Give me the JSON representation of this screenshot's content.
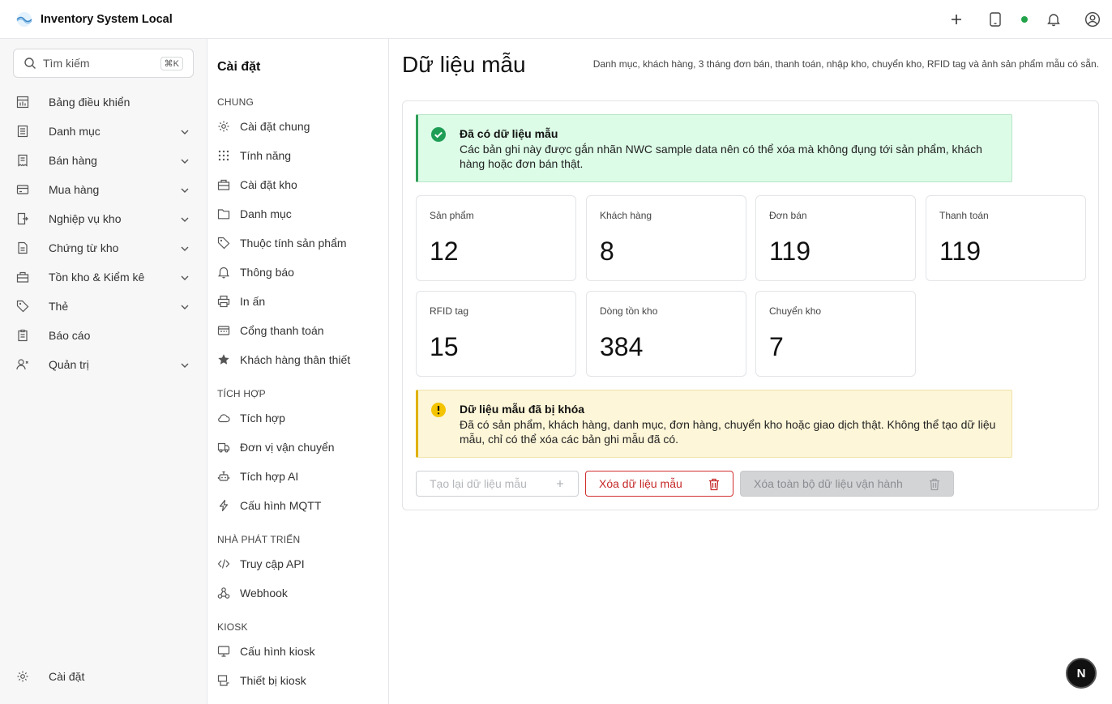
{
  "app": {
    "title": "Inventory System Local"
  },
  "topbar": {
    "actions": [
      "plus-icon",
      "tablet-icon",
      "status-dot",
      "bell-icon",
      "user-circle-icon"
    ],
    "status_color": "#22a34a"
  },
  "search": {
    "placeholder": "Tìm kiếm",
    "shortcut": "⌘K"
  },
  "sidebar": {
    "items": [
      {
        "label": "Bảng điều khiển",
        "icon": "dashboard-icon",
        "expandable": false
      },
      {
        "label": "Danh mục",
        "icon": "catalog-icon",
        "expandable": true
      },
      {
        "label": "Bán hàng",
        "icon": "receipt-icon",
        "expandable": true
      },
      {
        "label": "Mua hàng",
        "icon": "card-icon",
        "expandable": true
      },
      {
        "label": "Nghiệp vụ kho",
        "icon": "warehouse-ops-icon",
        "expandable": true
      },
      {
        "label": "Chứng từ kho",
        "icon": "document-icon",
        "expandable": true
      },
      {
        "label": "Tồn kho & Kiểm kê",
        "icon": "inventory-icon",
        "expandable": true
      },
      {
        "label": "Thẻ",
        "icon": "tag-icon",
        "expandable": true
      },
      {
        "label": "Báo cáo",
        "icon": "report-icon",
        "expandable": false
      },
      {
        "label": "Quản trị",
        "icon": "admin-icon",
        "expandable": true
      }
    ],
    "settings_label": "Cài đặt"
  },
  "settings_nav": {
    "title": "Cài đặt",
    "sections": [
      {
        "heading": "CHUNG",
        "items": [
          {
            "label": "Cài đặt chung",
            "icon": "gear-icon"
          },
          {
            "label": "Tính năng",
            "icon": "grid-dots-icon"
          },
          {
            "label": "Cài đặt kho",
            "icon": "warehouse-icon"
          },
          {
            "label": "Danh mục",
            "icon": "folder-icon"
          },
          {
            "label": "Thuộc tính sản phẩm",
            "icon": "tag-icon"
          },
          {
            "label": "Thông báo",
            "icon": "bell-icon"
          },
          {
            "label": "In ấn",
            "icon": "printer-icon"
          },
          {
            "label": "Cổng thanh toán",
            "icon": "payment-icon"
          },
          {
            "label": "Khách hàng thân thiết",
            "icon": "star-icon"
          }
        ]
      },
      {
        "heading": "TÍCH HỢP",
        "items": [
          {
            "label": "Tích hợp",
            "icon": "cloud-icon"
          },
          {
            "label": "Đơn vị vận chuyển",
            "icon": "truck-icon"
          },
          {
            "label": "Tích hợp AI",
            "icon": "robot-icon"
          },
          {
            "label": "Cấu hình MQTT",
            "icon": "bolt-icon"
          }
        ]
      },
      {
        "heading": "NHÀ PHÁT TRIỂN",
        "items": [
          {
            "label": "Truy cập API",
            "icon": "code-icon"
          },
          {
            "label": "Webhook",
            "icon": "webhook-icon"
          }
        ]
      },
      {
        "heading": "KIOSK",
        "items": [
          {
            "label": "Cấu hình kiosk",
            "icon": "monitor-icon"
          },
          {
            "label": "Thiết bị kiosk",
            "icon": "kiosk-device-icon"
          }
        ]
      }
    ]
  },
  "main": {
    "title": "Dữ liệu mẫu",
    "description": "Danh mục, khách hàng, 3 tháng đơn bán, thanh toán, nhập kho, chuyển kho, RFID tag và ảnh sản phẩm mẫu có sẵn.",
    "success_alert": {
      "title": "Đã có dữ liệu mẫu",
      "body": "Các bản ghi này được gắn nhãn NWC sample data nên có thể xóa mà không đụng tới sản phẩm, khách hàng hoặc đơn bán thật.",
      "color": "#2f9e57"
    },
    "stats": [
      {
        "label": "Sản phẩm",
        "value": "12"
      },
      {
        "label": "Khách hàng",
        "value": "8"
      },
      {
        "label": "Đơn bán",
        "value": "119"
      },
      {
        "label": "Thanh toán",
        "value": "119"
      },
      {
        "label": "RFID tag",
        "value": "15"
      },
      {
        "label": "Dòng tồn kho",
        "value": "384"
      },
      {
        "label": "Chuyển kho",
        "value": "7"
      }
    ],
    "warning_alert": {
      "title": "Dữ liệu mẫu đã bị khóa",
      "body": "Đã có sản phẩm, khách hàng, danh mục, đơn hàng, chuyển kho hoặc giao dịch thật. Không thể tạo dữ liệu mẫu, chỉ có thể xóa các bản ghi mẫu đã có.",
      "color": "#e0b100"
    },
    "buttons": {
      "regenerate": "Tạo lại dữ liệu mẫu",
      "delete_samples": "Xóa dữ liệu mẫu",
      "delete_all": "Xóa toàn bộ dữ liệu vận hành"
    },
    "danger_color": "#c62828"
  },
  "fab": {
    "label": "N"
  }
}
